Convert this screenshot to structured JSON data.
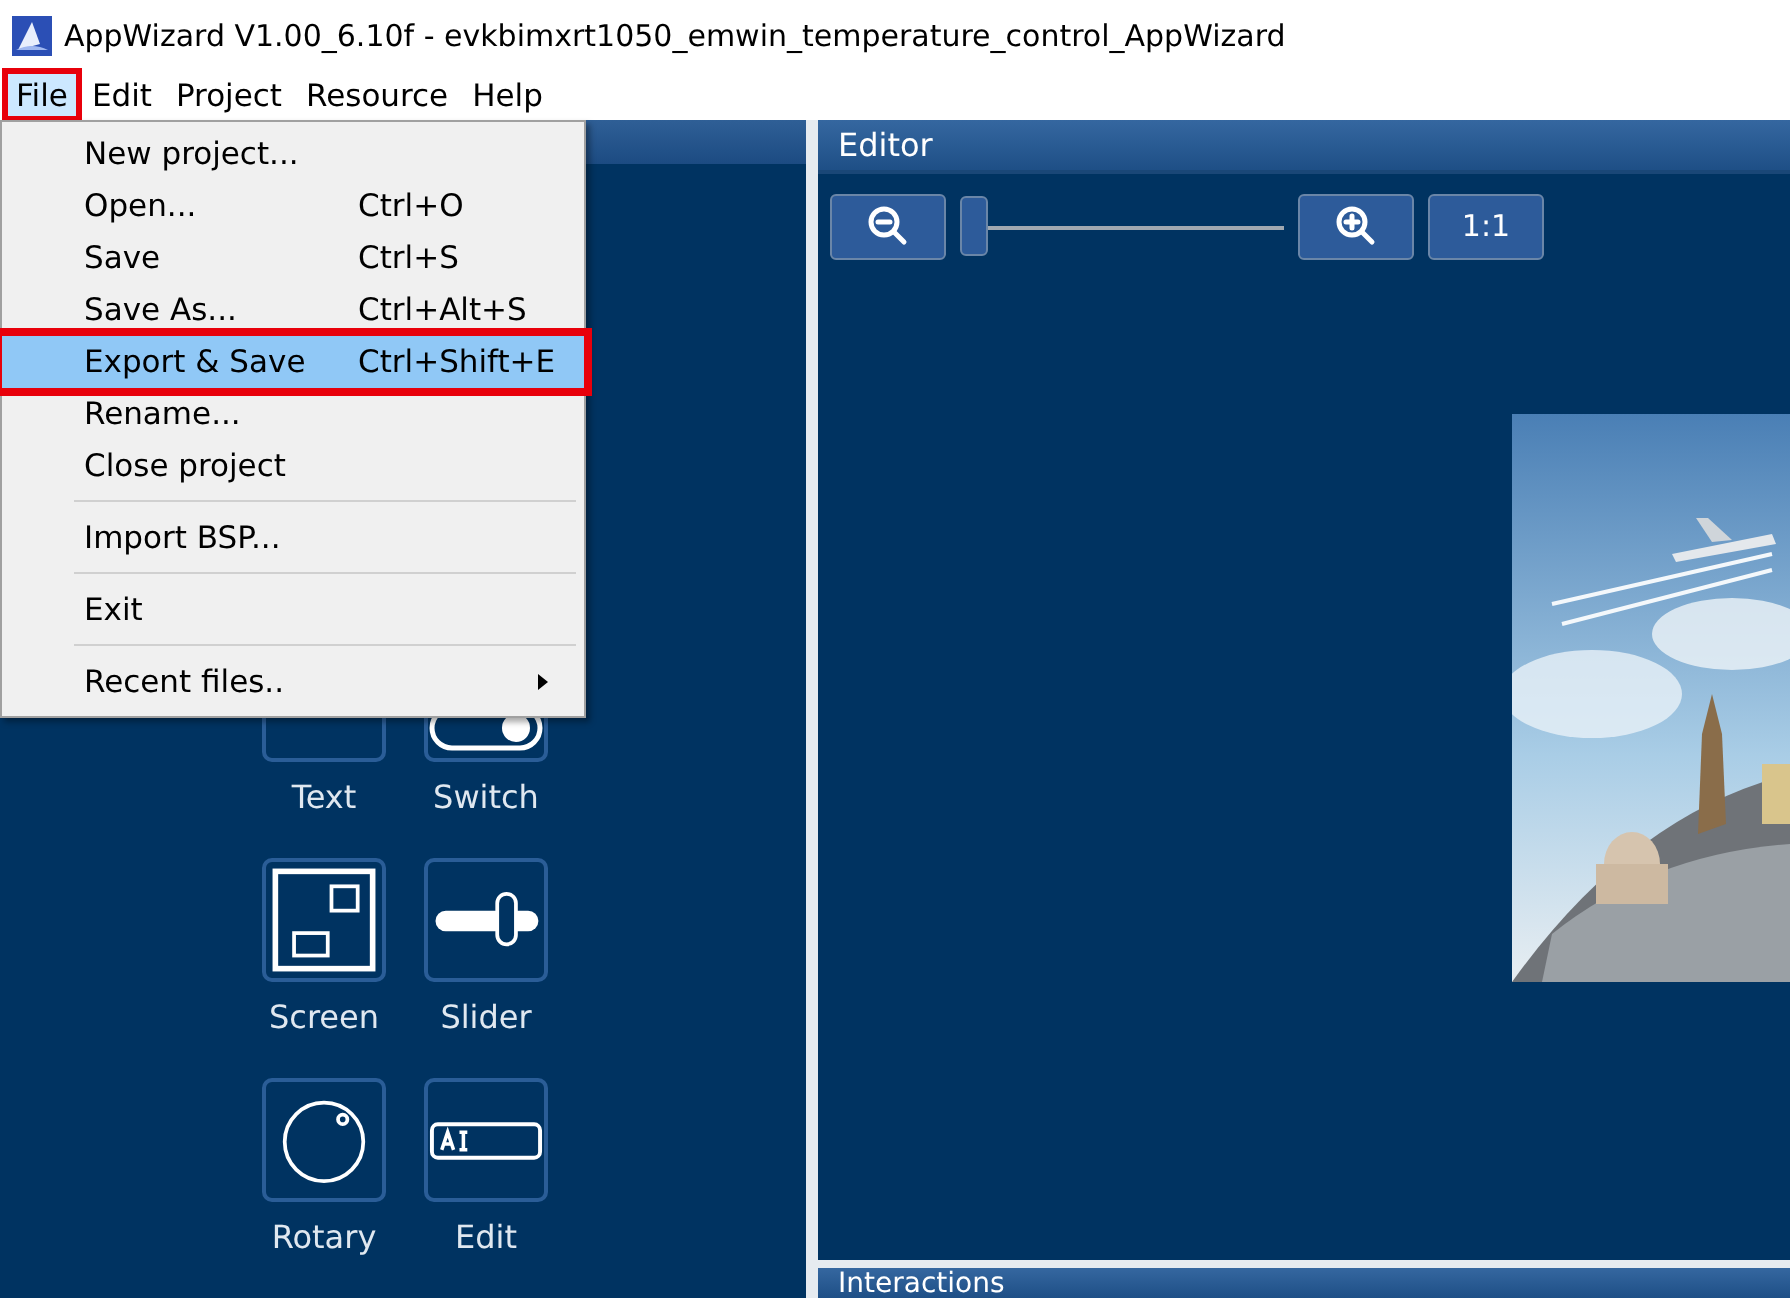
{
  "window": {
    "title": "AppWizard V1.00_6.10f - evkbimxrt1050_emwin_temperature_control_AppWizard"
  },
  "menubar": [
    {
      "label": "File",
      "selected": true,
      "highlighted": true
    },
    {
      "label": "Edit",
      "selected": false,
      "highlighted": false
    },
    {
      "label": "Project",
      "selected": false,
      "highlighted": false
    },
    {
      "label": "Resource",
      "selected": false,
      "highlighted": false
    },
    {
      "label": "Help",
      "selected": false,
      "highlighted": false
    }
  ],
  "file_menu": [
    {
      "kind": "item",
      "label": "New project...",
      "selected": false,
      "highlighted": false
    },
    {
      "kind": "item",
      "label": "Open...",
      "shortcut": "Ctrl+O",
      "selected": false,
      "highlighted": false
    },
    {
      "kind": "item",
      "label": "Save",
      "shortcut": "Ctrl+S",
      "selected": false,
      "highlighted": false
    },
    {
      "kind": "item",
      "label": "Save As...",
      "shortcut": "Ctrl+Alt+S",
      "selected": false,
      "highlighted": false
    },
    {
      "kind": "item",
      "label": "Export & Save",
      "shortcut": "Ctrl+Shift+E",
      "selected": true,
      "highlighted": true
    },
    {
      "kind": "item",
      "label": "Rename...",
      "selected": false,
      "highlighted": false
    },
    {
      "kind": "item",
      "label": "Close project",
      "selected": false,
      "highlighted": false
    },
    {
      "kind": "separator"
    },
    {
      "kind": "item",
      "label": "Import BSP...",
      "selected": false,
      "highlighted": false
    },
    {
      "kind": "separator"
    },
    {
      "kind": "item",
      "label": "Exit",
      "selected": false,
      "highlighted": false
    },
    {
      "kind": "separator"
    },
    {
      "kind": "submenu",
      "label": "Recent files..",
      "selected": false,
      "highlighted": false
    }
  ],
  "widgets": [
    {
      "kind": "text",
      "label": "Text"
    },
    {
      "kind": "switch",
      "label": "Switch"
    },
    {
      "kind": "screen",
      "label": "Screen"
    },
    {
      "kind": "slider",
      "label": "Slider"
    },
    {
      "kind": "rotary",
      "label": "Rotary"
    },
    {
      "kind": "edit",
      "label": "Edit"
    }
  ],
  "editor": {
    "title": "Editor",
    "zoom": {
      "level": 0
    },
    "reset_label": "1:1"
  },
  "interactions": {
    "title": "Interactions"
  }
}
